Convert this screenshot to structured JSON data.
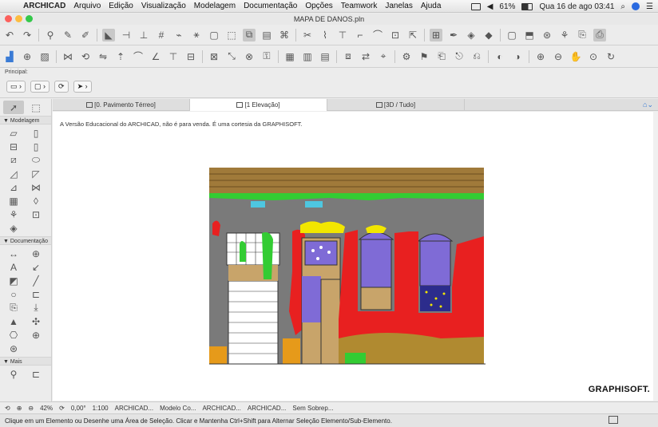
{
  "menubar": {
    "app": "ARCHICAD",
    "items": [
      "Arquivo",
      "Edição",
      "Visualização",
      "Modelagem",
      "Documentação",
      "Opções",
      "Teamwork",
      "Janelas",
      "Ajuda"
    ],
    "battery": "61%",
    "clock": "Qua 16 de ago  03:41"
  },
  "window": {
    "title": "MAPA DE DANOS.pln"
  },
  "info": {
    "label": "Principal:"
  },
  "toolbox": {
    "sections": [
      {
        "label": "Modelagem"
      },
      {
        "label": "Documentação"
      },
      {
        "label": "Mais"
      }
    ]
  },
  "tabs": [
    {
      "label": "[0. Pavimento Térreo]"
    },
    {
      "label": "[1 Elevação]"
    },
    {
      "label": "[3D / Tudo]"
    }
  ],
  "canvas": {
    "note": "A Versão Educacional do ARCHICAD, não é para venda. É uma cortesia da GRAPHISOFT.",
    "brand": "GRAPHISOFT."
  },
  "status": {
    "zoom": "42%",
    "angle": "0,00°",
    "scale": "1:100",
    "items": [
      "ARCHICAD...",
      "Modelo Co...",
      "ARCHICAD...",
      "ARCHICAD...",
      "Sem Sobrep..."
    ]
  },
  "hint": "Clique em um Elemento ou Desenhe uma Área de Seleção. Clicar e Mantenha Ctrl+Shift para Alternar Seleção Elemento/Sub-Elemento.",
  "colors": {
    "damage_red": "#e82020",
    "facade_gray": "#7a7a7a",
    "roof": "#a07a3a",
    "vegetation": "#33cc33",
    "window_purple": "#7f6bd6",
    "yellow": "#f2e600",
    "orange": "#e69a1a",
    "cyan": "#4ec7e0"
  }
}
